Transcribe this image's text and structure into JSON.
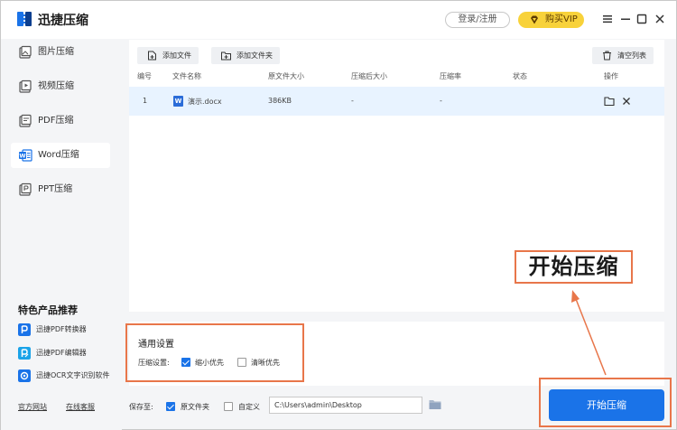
{
  "app": {
    "title": "迅捷压缩",
    "login_label": "登录/注册",
    "vip_label": "购买VIP"
  },
  "sidebar": {
    "items": [
      {
        "label": "图片压缩",
        "icon": "image-icon"
      },
      {
        "label": "视频压缩",
        "icon": "video-icon"
      },
      {
        "label": "PDF压缩",
        "icon": "pdf-icon"
      },
      {
        "label": "Word压缩",
        "icon": "word-icon",
        "active": true
      },
      {
        "label": "PPT压缩",
        "icon": "ppt-icon"
      }
    ],
    "promo_title": "特色产品推荐",
    "promo_items": [
      {
        "label": "迅捷PDF转换器",
        "color": "#1a73e8"
      },
      {
        "label": "迅捷PDF编辑器",
        "color": "#1aa3e8"
      },
      {
        "label": "迅捷OCR文字识别软件",
        "color": "#1a73e8"
      }
    ],
    "footer_links": [
      "官方网站",
      "在线客服"
    ]
  },
  "toolbar": {
    "add_file": "添加文件",
    "add_folder": "添加文件夹",
    "clear_list": "清空列表"
  },
  "table": {
    "headers": [
      "编号",
      "文件名称",
      "原文件大小",
      "压缩后大小",
      "压缩率",
      "状态",
      "操作"
    ],
    "rows": [
      {
        "index": "1",
        "name": "演示.docx",
        "original_size": "386KB",
        "compressed_size": "-",
        "ratio": "-",
        "status": ""
      }
    ]
  },
  "settings": {
    "title": "通用设置",
    "label": "压缩设置:",
    "options": [
      {
        "label": "缩小优先",
        "checked": true
      },
      {
        "label": "清晰优先",
        "checked": false
      }
    ]
  },
  "bottom": {
    "save_to_label": "保存至:",
    "original_folder_label": "原文件夹",
    "original_folder_checked": true,
    "custom_label": "自定义",
    "custom_checked": false,
    "path_value": "C:\\Users\\admin\\Desktop",
    "start_label": "开始压缩"
  },
  "annotation": {
    "callout_text": "开始压缩",
    "color": "#e8764a"
  },
  "colors": {
    "accent": "#1a73e8",
    "vip": "#f8d23a",
    "row_highlight": "#e8f3ff"
  }
}
